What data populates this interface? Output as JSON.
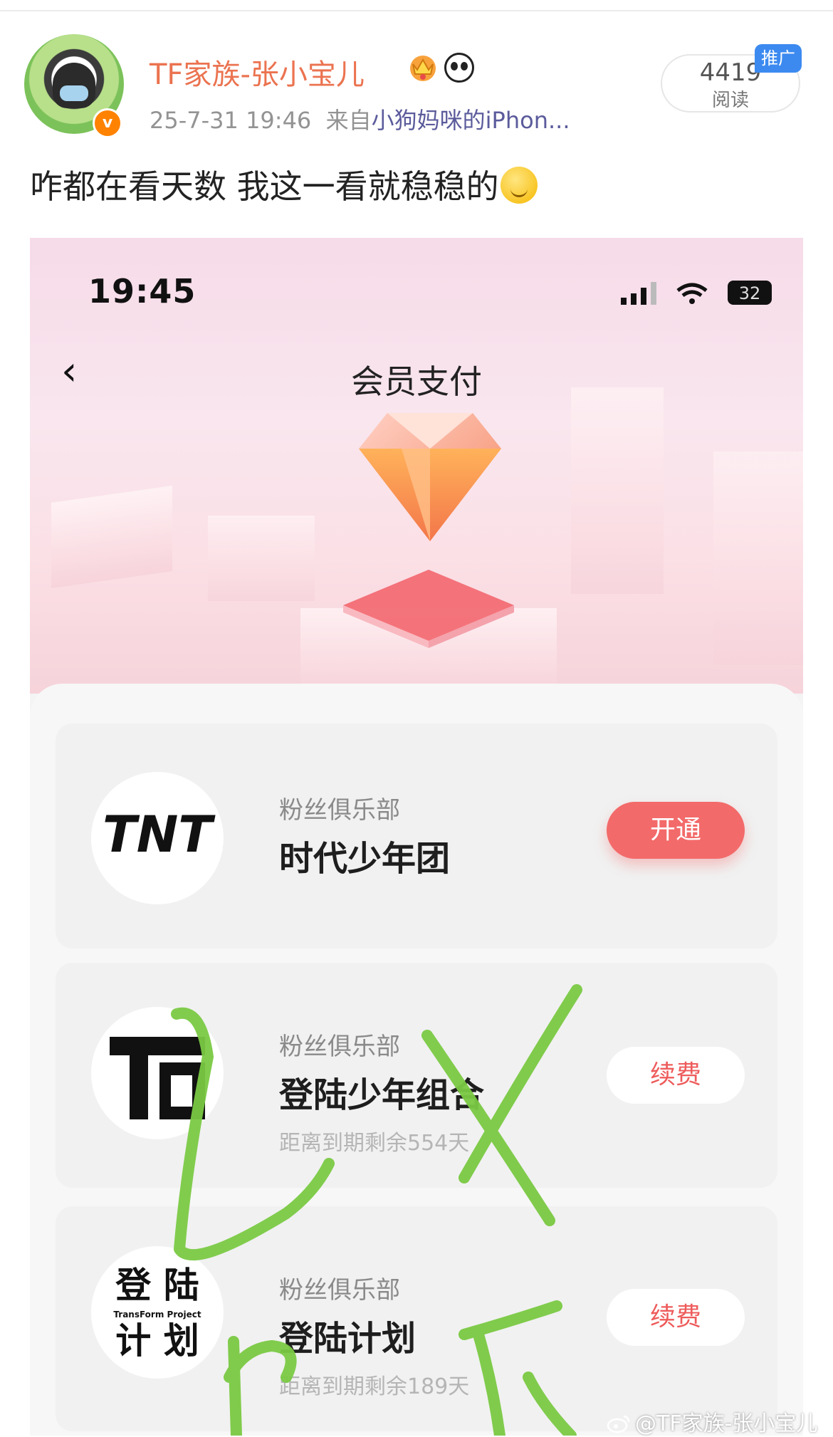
{
  "post": {
    "username": "TF家族-张小宝儿",
    "timestamp": "25-7-31 19:46",
    "source_prefix": "来自",
    "source": "小狗妈咪的iPhon...",
    "reads_count": "4419",
    "reads_label": "阅读",
    "promo_tag": "推广",
    "text": "咋都在看天数 我这一看就稳稳的",
    "badges": [
      "crown-badge-icon",
      "panda-badge-icon"
    ],
    "emoji": "smile-emoji"
  },
  "screenshot": {
    "status_time": "19:45",
    "battery": "32",
    "title": "会员支付",
    "clubs": [
      {
        "label": "粉丝俱乐部",
        "name": "时代少年团",
        "expiry": "",
        "action": "开通",
        "logo": "TNT"
      },
      {
        "label": "粉丝俱乐部",
        "name": "登陆少年组合",
        "expiry": "距离到期剩余554天",
        "action": "续费",
        "logo": "TF"
      },
      {
        "label": "粉丝俱乐部",
        "name": "登陆计划",
        "expiry": "距离到期剩余189天",
        "action": "续费",
        "logo_lines": [
          "登 陆",
          "TransForm Project",
          "计 划"
        ]
      }
    ]
  },
  "watermark": "@TF家族-张小宝儿",
  "colors": {
    "username": "#eb7350",
    "accent_red": "#f36a6a",
    "promo_blue": "#3c8af0",
    "scribble_green": "#7ac943"
  }
}
